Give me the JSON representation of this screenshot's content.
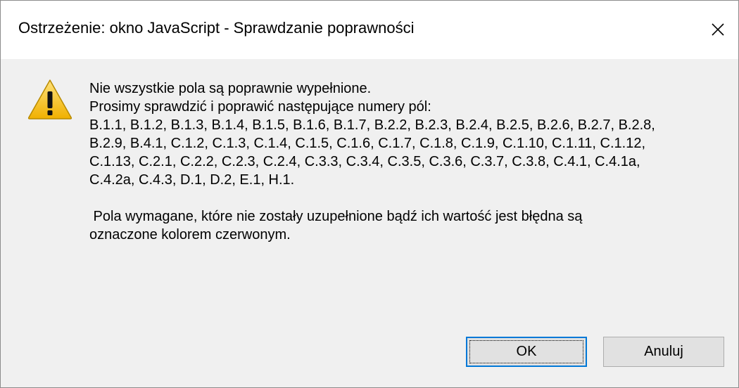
{
  "window": {
    "title": "Ostrzeżenie: okno JavaScript - Sprawdzanie poprawności",
    "close_symbol": "×"
  },
  "message": {
    "line1": "Nie wszystkie pola są poprawnie wypełnione.",
    "line2": "Prosimy sprawdzić i poprawić następujące numery pól:",
    "fields_line1": "B.1.1, B.1.2, B.1.3, B.1.4, B.1.5, B.1.6, B.1.7, B.2.2, B.2.3, B.2.4, B.2.5, B.2.6, B.2.7, B.2.8,",
    "fields_line2": "B.2.9, B.4.1, C.1.2, C.1.3, C.1.4, C.1.5, C.1.6, C.1.7, C.1.8, C.1.9, C.1.10, C.1.11, C.1.12,",
    "fields_line3": "C.1.13, C.2.1, C.2.2, C.2.3, C.2.4, C.3.3, C.3.4, C.3.5, C.3.6, C.3.7, C.3.8, C.4.1, C.4.1a,",
    "fields_line4": "C.4.2a, C.4.3, D.1, D.2, E.1, H.1.",
    "note_line1": " Pola wymagane, które nie zostały uzupełnione bądź ich wartość jest błędna są",
    "note_line2": "oznaczone kolorem czerwonym."
  },
  "buttons": {
    "ok_label": "OK",
    "cancel_label": "Anuluj"
  },
  "icons": {
    "warning": "warning-icon",
    "close": "close-icon"
  },
  "colors": {
    "focus_border": "#0078d7",
    "warning_fill": "#f5c518"
  }
}
